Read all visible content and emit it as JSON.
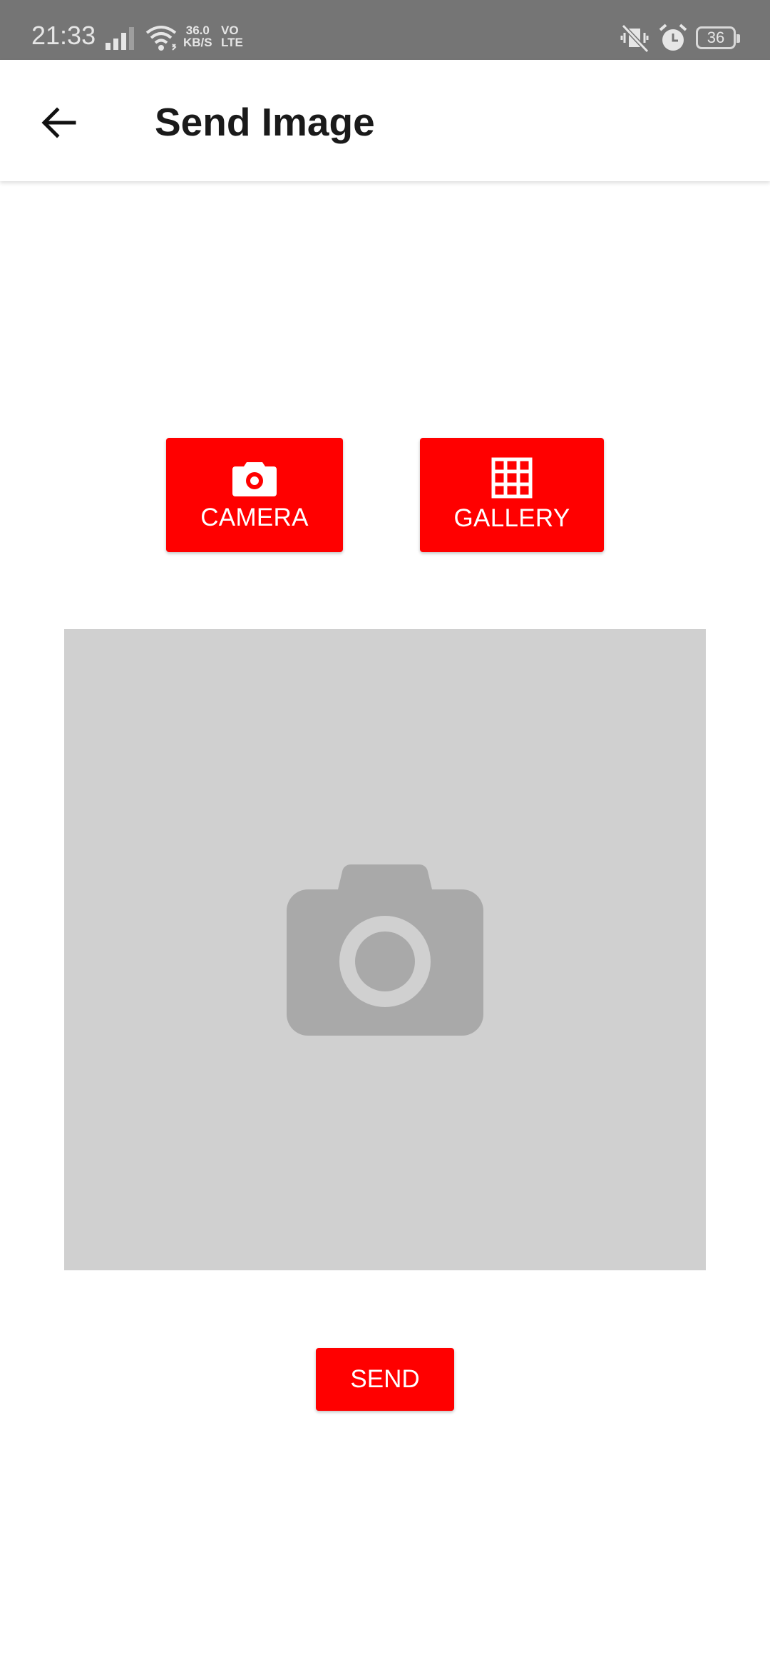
{
  "status_bar": {
    "time": "21:33",
    "net_speed_value": "36.0",
    "net_speed_unit": "KB/S",
    "volte_top": "VO",
    "volte_bottom": "LTE",
    "battery": "36",
    "icons": [
      "signal-icon",
      "wifi-icon",
      "mute-vibrate-icon",
      "alarm-icon",
      "battery-icon"
    ]
  },
  "app_bar": {
    "title": "Send Image",
    "back_icon": "arrow-back-icon"
  },
  "actions": {
    "camera_label": "CAMERA",
    "camera_icon": "camera-icon",
    "gallery_label": "GALLERY",
    "gallery_icon": "grid-icon"
  },
  "preview": {
    "placeholder_icon": "camera-placeholder-icon"
  },
  "send": {
    "label": "SEND"
  },
  "colors": {
    "accent": "#ff0000",
    "status_bar": "#757575",
    "preview_bg": "#d0d0d0",
    "placeholder_icon": "#a9a9a9"
  }
}
